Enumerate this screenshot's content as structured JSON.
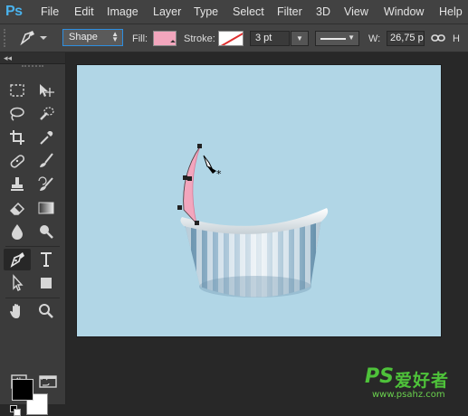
{
  "app": {
    "logo": "Ps"
  },
  "menu": [
    "File",
    "Edit",
    "Image",
    "Layer",
    "Type",
    "Select",
    "Filter",
    "3D",
    "View",
    "Window",
    "Help"
  ],
  "options": {
    "mode": "Shape",
    "fill_label": "Fill:",
    "fill_color": "#f2a6bd",
    "stroke_label": "Stroke:",
    "stroke_width": "3 pt",
    "width_label": "W:",
    "width_value": "26,75 p",
    "height_label": "H"
  },
  "colors": {
    "foreground": "#000000",
    "background": "#ffffff",
    "canvas": "#b1d6e6"
  },
  "watermark": {
    "brand": "PS",
    "name": "爱好者",
    "url": "www.psahz.com"
  }
}
